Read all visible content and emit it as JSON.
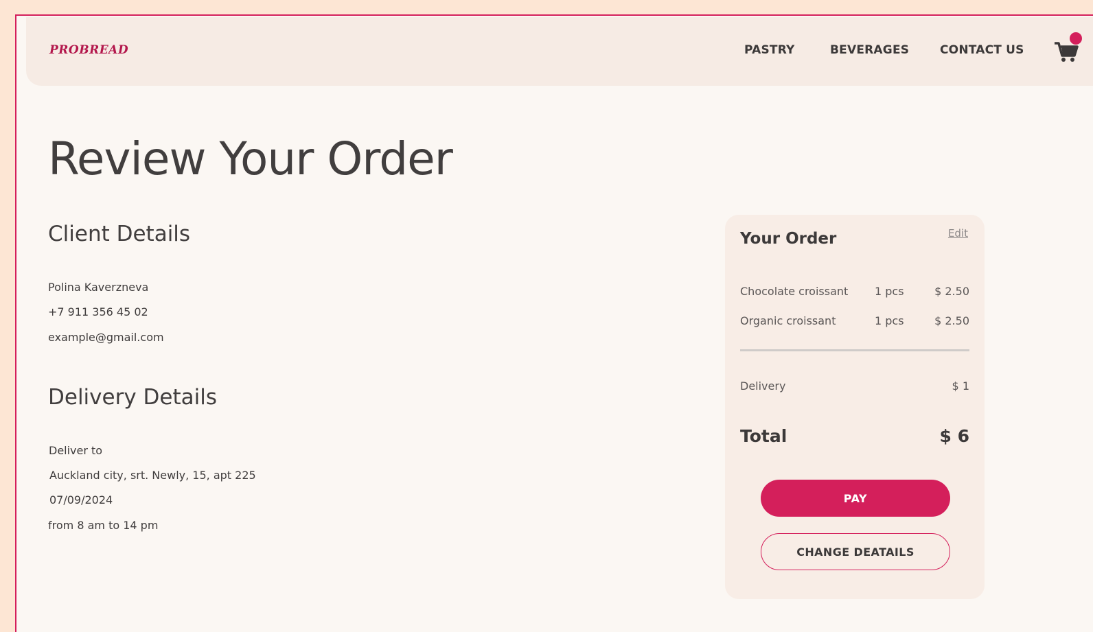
{
  "header": {
    "logo": "PROBREAD",
    "nav": [
      "PASTRY",
      "BEVERAGES",
      "CONTACT US"
    ]
  },
  "page_title": "Review Your Order",
  "client": {
    "title": "Client Details",
    "name": "Polina Kaverzneva",
    "phone": "+7 911 356 45 02",
    "email": "example@gmail.com"
  },
  "delivery": {
    "title": "Delivery Details",
    "label": "Deliver to",
    "address": "Auckland city, srt. Newly, 15, apt 225",
    "date": "07/09/2024",
    "time": "from 8 am to 14 pm"
  },
  "order": {
    "title": "Your Order",
    "edit_label": "Edit",
    "items": [
      {
        "name": "Chocolate croissant",
        "qty": "1 pcs",
        "price": "$ 2.50"
      },
      {
        "name": "Organic croissant",
        "qty": "1 pcs",
        "price": "$ 2.50"
      }
    ],
    "delivery_label": "Delivery",
    "delivery_value": "$ 1",
    "total_label": "Total",
    "total_value": "$ 6",
    "pay_label": "PAY",
    "change_label": "CHANGE DEATAILS"
  },
  "colors": {
    "accent": "#d41f5b",
    "page_bg": "#fde6d4",
    "content_bg": "#fbf7f3",
    "header_bg": "#f6ebe4",
    "card_bg": "#f8ede6"
  },
  "icons": [
    "cart-icon"
  ]
}
